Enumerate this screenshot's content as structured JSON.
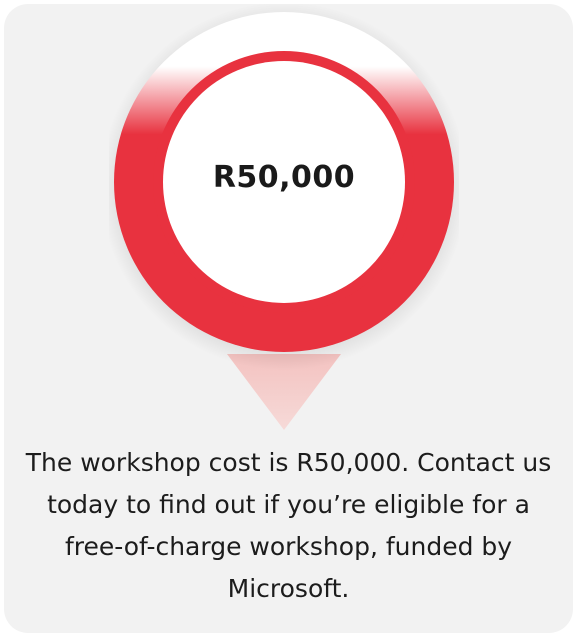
{
  "card": {
    "price": "R50,000",
    "description": "The workshop cost is R50,000. Contact us today to find out if you’re eligible for a free-of-charge workshop, funded by Microsoft."
  },
  "colors": {
    "accent": "#e63340",
    "card_background": "#f2f2f2",
    "text": "#1c1c1c"
  },
  "icons": [
    "location-pin-icon"
  ]
}
